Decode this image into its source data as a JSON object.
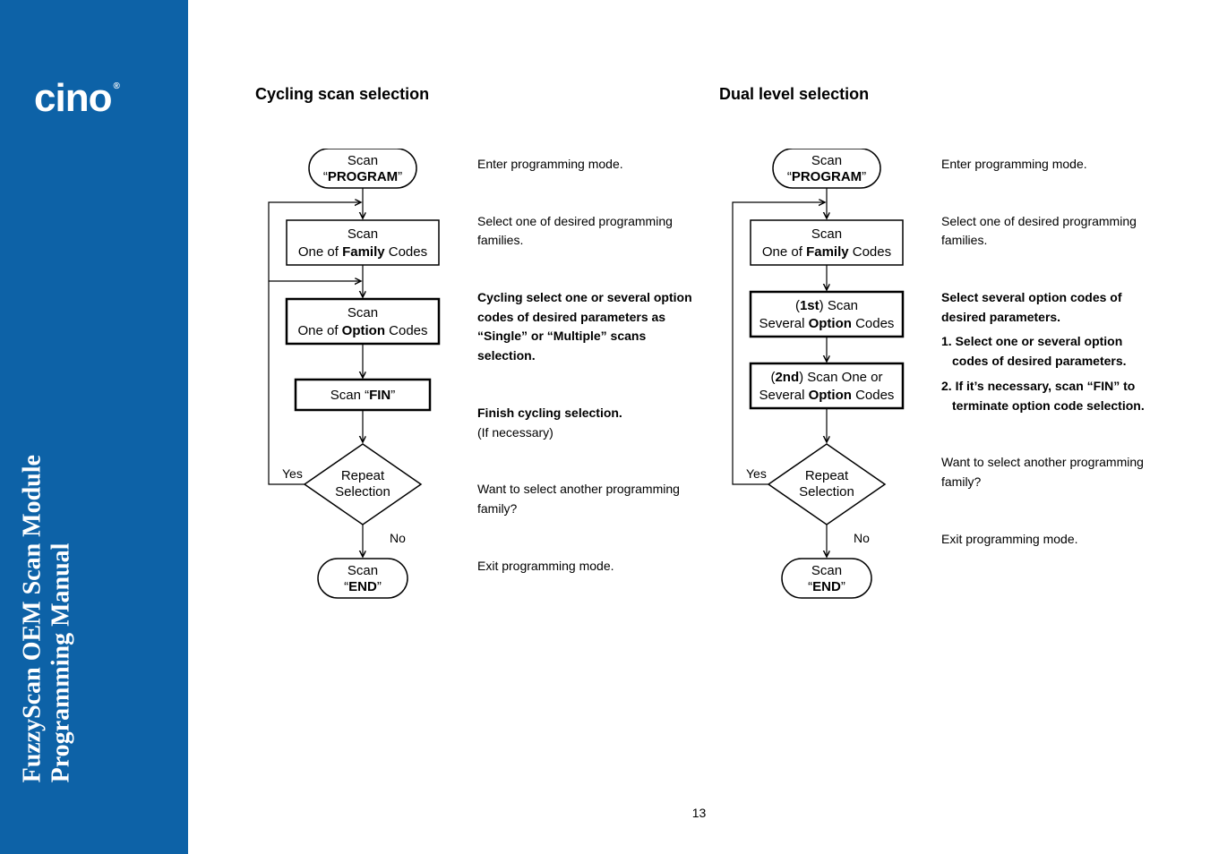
{
  "brand": "cino",
  "sidebar_title_line1": "FuzzyScan OEM Scan Module",
  "sidebar_title_line2": "Programming Manual",
  "page_number": "13",
  "left": {
    "title": "Cycling scan selection",
    "flow": {
      "prog_l1": "Scan",
      "prog_l2_pre": "“",
      "prog_l2_b": "PROGRAM",
      "prog_l2_post": "”",
      "fam_l1": "Scan",
      "fam_l2_pre": "One of ",
      "fam_l2_b": "Family",
      "fam_l2_post": " Codes",
      "opt_l1": "Scan",
      "opt_l2_pre": "One of ",
      "opt_l2_b": "Option",
      "opt_l2_post": " Codes",
      "fin_pre": "Scan “",
      "fin_b": "FIN",
      "fin_post": "”",
      "dec_l1": "Repeat",
      "dec_l2": "Selection",
      "yes": "Yes",
      "no": "No",
      "end_l1": "Scan",
      "end_l2_pre": "“",
      "end_l2_b": "END",
      "end_l2_post": "”"
    },
    "notes": {
      "n1": "Enter programming mode.",
      "n2": "Select one of desired programming families.",
      "n3": "Cycling select one or several option codes of desired parameters as “Single” or “Multiple” scans selection.",
      "n4a": "Finish cycling selection.",
      "n4b": "(If necessary)",
      "n5": "Want to select another programming family?",
      "n6": "Exit programming mode."
    }
  },
  "right": {
    "title": "Dual level selection",
    "flow": {
      "prog_l1": "Scan",
      "prog_l2_pre": "“",
      "prog_l2_b": "PROGRAM",
      "prog_l2_post": "”",
      "fam_l1": "Scan",
      "fam_l2_pre": "One of ",
      "fam_l2_b": "Family",
      "fam_l2_post": " Codes",
      "opt1_l1_pre": "(",
      "opt1_l1_b": "1st",
      "opt1_l1_post": ") Scan",
      "opt1_l2_pre": "Several ",
      "opt1_l2_b": "Option",
      "opt1_l2_post": " Codes",
      "opt2_l1_pre": "(",
      "opt2_l1_b": "2nd",
      "opt2_l1_post": ") Scan One or",
      "opt2_l2_pre": "Several ",
      "opt2_l2_b": "Option",
      "opt2_l2_post": " Codes",
      "dec_l1": "Repeat",
      "dec_l2": "Selection",
      "yes": "Yes",
      "no": "No",
      "end_l1": "Scan",
      "end_l2_pre": "“",
      "end_l2_b": "END",
      "end_l2_post": "”"
    },
    "notes": {
      "n1": "Enter programming mode.",
      "n2": "Select one of desired programming families.",
      "n3h": "Select several option codes of desired parameters.",
      "n3_1": "1. Select one or several option codes of desired parameters.",
      "n3_2": "2. If it’s necessary, scan “FIN” to terminate option code selection.",
      "n5": "Want to select another programming family?",
      "n6": "Exit programming mode."
    }
  }
}
